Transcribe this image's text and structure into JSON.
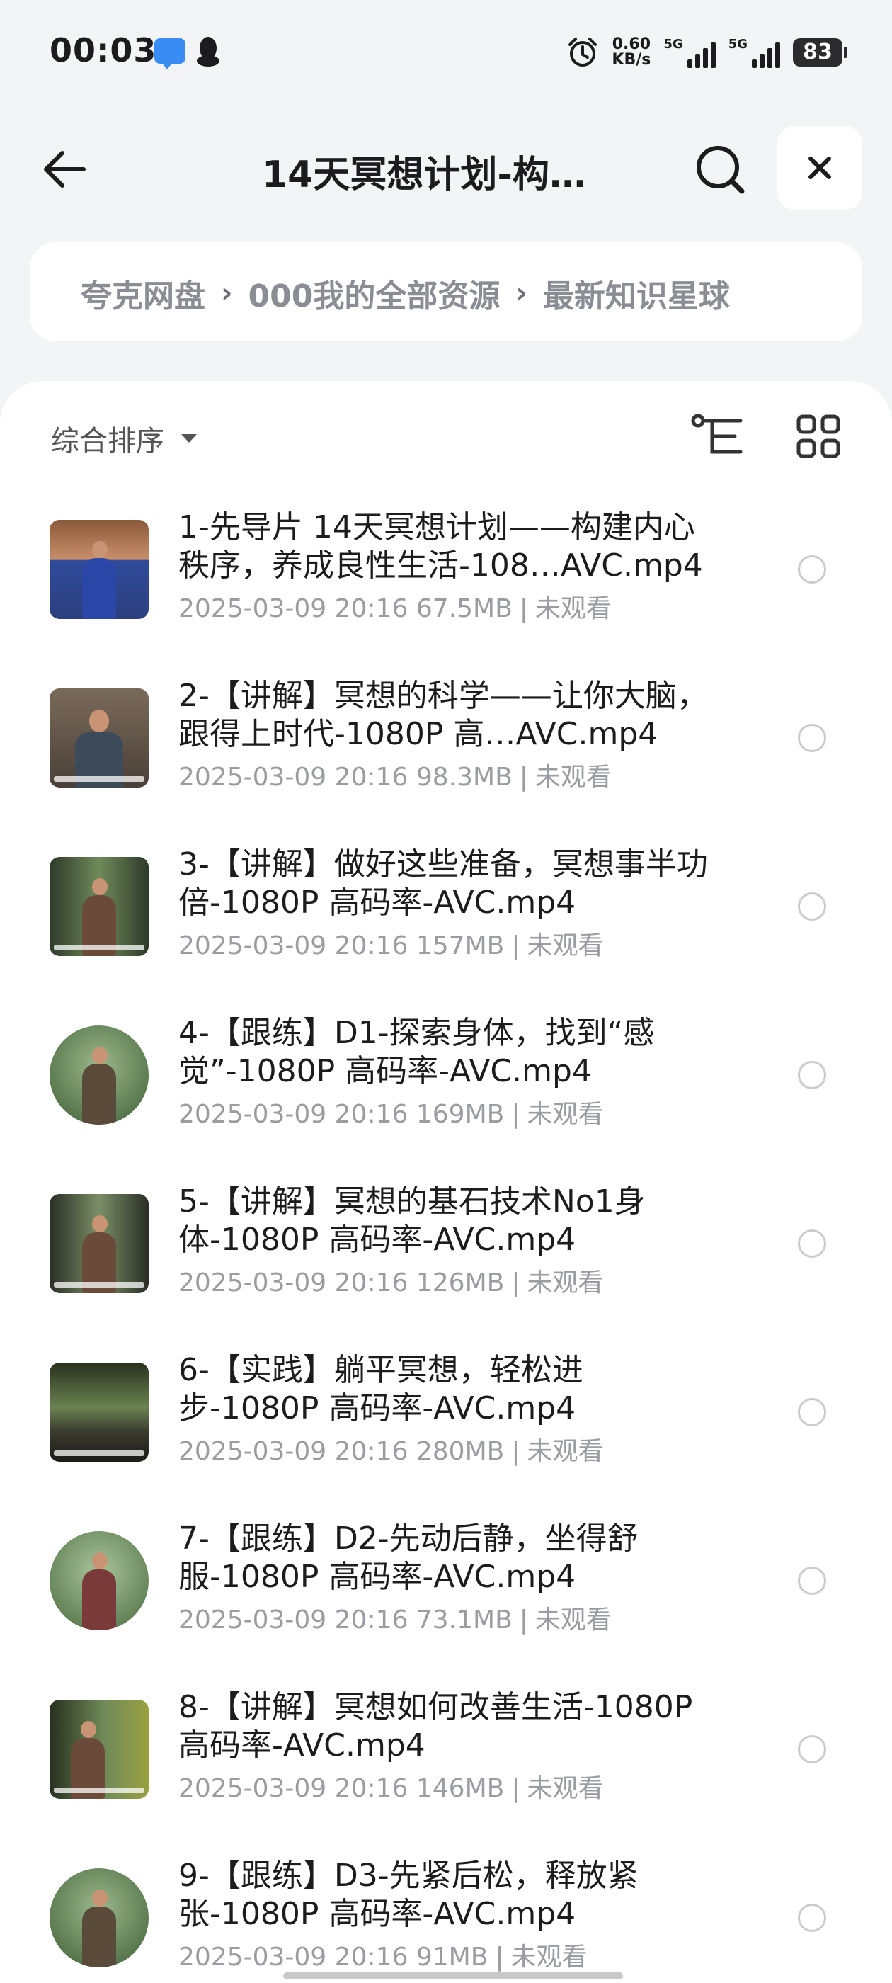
{
  "status": {
    "time": "00:03",
    "speed_top": "0.60",
    "speed_bottom": "KB/s",
    "sim1": "5G",
    "sim2": "5G",
    "battery": "83"
  },
  "header": {
    "title": "14天冥想计划-构…"
  },
  "breadcrumb": {
    "items": [
      "夸克网盘",
      "000我的全部资源",
      "最新知识星球"
    ]
  },
  "toolbar": {
    "sort_label": "综合排序"
  },
  "files": [
    {
      "name": "1-先导片 14天冥想计划——构建内心秩序，养成良性生活-108…AVC.mp4",
      "date": "2025-03-09 20:16",
      "size": "67.5MB",
      "status": "未观看"
    },
    {
      "name": "2-【讲解】冥想的科学——让你大脑，跟得上时代-1080P 高…AVC.mp4",
      "date": "2025-03-09 20:16",
      "size": "98.3MB",
      "status": "未观看"
    },
    {
      "name": "3-【讲解】做好这些准备，冥想事半功倍-1080P 高码率-AVC.mp4",
      "date": "2025-03-09 20:16",
      "size": "157MB",
      "status": "未观看"
    },
    {
      "name": "4-【跟练】D1-探索身体，找到“感觉”-1080P 高码率-AVC.mp4",
      "date": "2025-03-09 20:16",
      "size": "169MB",
      "status": "未观看"
    },
    {
      "name": "5-【讲解】冥想的基石技术No1身体-1080P 高码率-AVC.mp4",
      "date": "2025-03-09 20:16",
      "size": "126MB",
      "status": "未观看"
    },
    {
      "name": "6-【实践】躺平冥想，轻松进步-1080P 高码率-AVC.mp4",
      "date": "2025-03-09 20:16",
      "size": "280MB",
      "status": "未观看"
    },
    {
      "name": "7-【跟练】D2-先动后静，坐得舒服-1080P 高码率-AVC.mp4",
      "date": "2025-03-09 20:16",
      "size": "73.1MB",
      "status": "未观看"
    },
    {
      "name": "8-【讲解】冥想如何改善生活-1080P 高码率-AVC.mp4",
      "date": "2025-03-09 20:16",
      "size": "146MB",
      "status": "未观看"
    },
    {
      "name": "9-【跟练】D3-先紧后松，释放紧张-1080P 高码率-AVC.mp4",
      "date": "2025-03-09 20:16",
      "size": "91MB",
      "status": "未观看"
    }
  ]
}
